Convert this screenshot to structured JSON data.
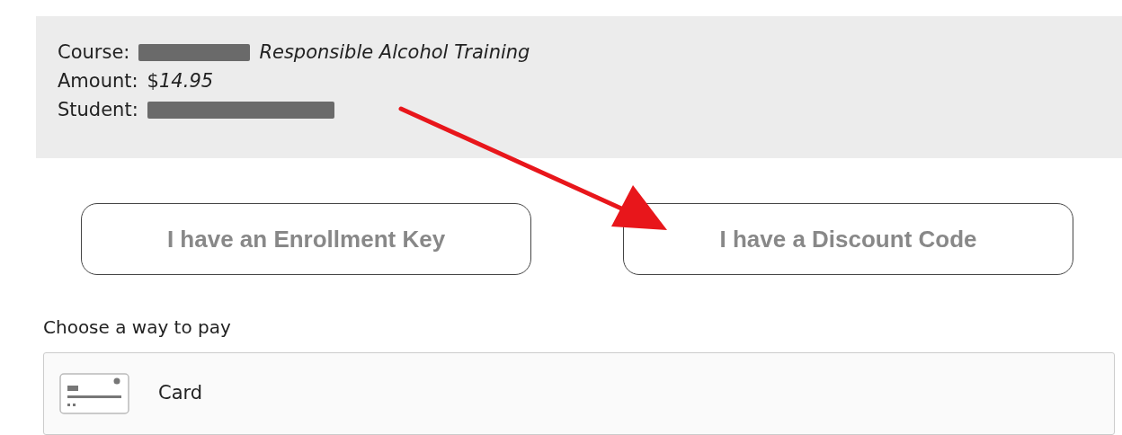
{
  "summary": [
    {
      "label": "Course:",
      "redacted": true,
      "value": "Responsible Alcohol Training",
      "italic": true
    },
    {
      "label": "Amount:",
      "redacted": false,
      "value": "$*14.95*",
      "italic": false
    },
    {
      "label": "Student:",
      "redacted": true
    }
  ],
  "buttons": [
    "I have an Enrollment Key",
    "I have a Discount Code"
  ],
  "payment": {
    "heading": "Choose a way to pay",
    "methods": [
      {
        "label": "Card"
      }
    ]
  }
}
